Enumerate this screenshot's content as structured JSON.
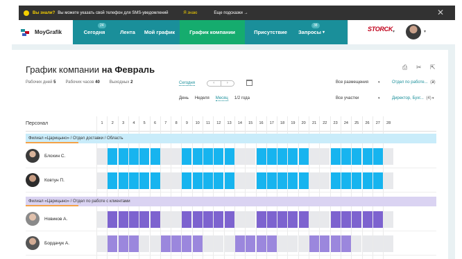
{
  "notice": {
    "question": "Вы знали?",
    "message": "Вы можете указать свой телефон для SMS-уведомлений",
    "know": "Я знаю",
    "more": "Еще подсказки →",
    "close": "✕"
  },
  "nav": {
    "logo": "MoyGrafik",
    "tabs": [
      {
        "label": "Сегодня",
        "badge": "24"
      },
      {
        "label": "Лента"
      },
      {
        "label": "Мой график"
      },
      {
        "label": "График компании"
      },
      {
        "label": "Присутствие"
      },
      {
        "label": "Запросы",
        "badge": "38"
      }
    ],
    "company": "STORCK"
  },
  "page": {
    "title_prefix": "График компании",
    "title_month": "на Февраль",
    "stats": [
      {
        "label": "Рабочих дней",
        "value": "5"
      },
      {
        "label": "Рабочих часов",
        "value": "40"
      },
      {
        "label": "Выходных",
        "value": "2"
      }
    ],
    "today": "Сегодня",
    "arrow_prev": "‹",
    "arrow_next": "›",
    "periods": [
      "День",
      "Неделя",
      "Месяц",
      "1/2 года"
    ],
    "filters": {
      "placement": "Все размещения",
      "department": "Отдел по работе...",
      "department_count": "(2)",
      "participants": "Все участки",
      "role": "Директор, Бухг...",
      "role_count": "(4)"
    }
  },
  "grid": {
    "personnel_label": "Персонал",
    "days": [
      "1",
      "2",
      "3",
      "4",
      "5",
      "6",
      "7",
      "8",
      "9",
      "10",
      "11",
      "12",
      "13",
      "14",
      "15",
      "16",
      "17",
      "18",
      "19",
      "20",
      "21",
      "22",
      "23",
      "24",
      "25",
      "26",
      "27",
      "28"
    ],
    "groups": [
      {
        "label": "Филиал «Царицыно» / Отдел доставки / Область",
        "band_color": "#c9ecfa",
        "employees": [
          {
            "name": "Блохин С.",
            "work": [
              0,
              1,
              1,
              1,
              1,
              1,
              0,
              0,
              1,
              1,
              1,
              1,
              1,
              0,
              0,
              1,
              1,
              1,
              1,
              1,
              0,
              0,
              1,
              1,
              1,
              1,
              1,
              0
            ],
            "color": "#17b4ef"
          },
          {
            "name": "Ковтун П.",
            "work": [
              0,
              1,
              1,
              1,
              1,
              1,
              0,
              0,
              1,
              1,
              1,
              1,
              1,
              0,
              0,
              1,
              1,
              1,
              1,
              1,
              0,
              0,
              1,
              1,
              1,
              1,
              1,
              0
            ],
            "color": "#17b4ef"
          }
        ]
      },
      {
        "label": "Филиал «Царицыно» / Отдел по работе с клиентами",
        "band_color": "#dad3f2",
        "employees": [
          {
            "name": "Новиков А.",
            "work": [
              0,
              1,
              1,
              1,
              1,
              1,
              0,
              0,
              1,
              1,
              1,
              1,
              1,
              0,
              0,
              1,
              1,
              1,
              1,
              1,
              0,
              0,
              1,
              1,
              1,
              1,
              1,
              0
            ],
            "color": "#7d63cf"
          },
          {
            "name": "Бордачук А.",
            "work": [
              0,
              1,
              1,
              1,
              0,
              0,
              1,
              1,
              1,
              1,
              0,
              0,
              0,
              1,
              1,
              1,
              1,
              0,
              0,
              0,
              1,
              1,
              1,
              1,
              0,
              0,
              0,
              0
            ],
            "color": "#9b87dd"
          }
        ]
      }
    ],
    "off_color": "#e8e9ec"
  }
}
